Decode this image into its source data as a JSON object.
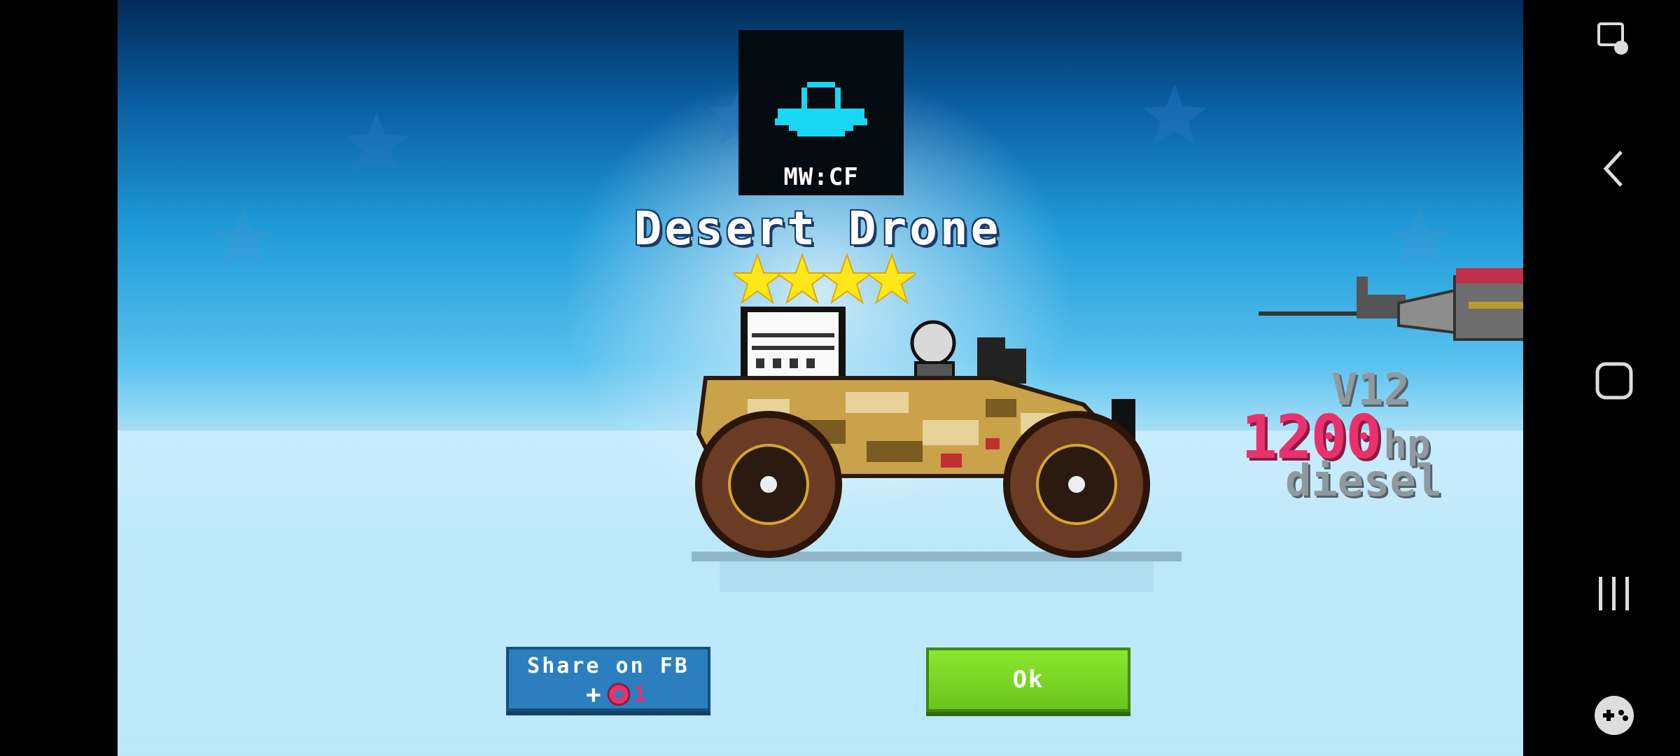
{
  "badge": {
    "label": "MW:CF",
    "icon": "ufo-icon"
  },
  "vehicle": {
    "name": "Desert Drone",
    "stars": 4,
    "stars_max": 4
  },
  "engine": {
    "type": "V12",
    "hp": "1200",
    "unit": "hp",
    "fuel": "diesel"
  },
  "buttons": {
    "share": {
      "label": "Share on FB",
      "reward_plus": "+",
      "reward_count": "1",
      "reward_icon": "donut-icon"
    },
    "ok": {
      "label": "Ok"
    }
  },
  "nav": {
    "icons": [
      "screen-touch-icon",
      "back-icon",
      "home-icon",
      "recents-icon",
      "game-controller-icon"
    ]
  },
  "colors": {
    "ok_green": "#7ad424",
    "share_blue": "#2b7fbf",
    "hp_pink": "#e8326e",
    "badge_cyan": "#19d6f2",
    "star_yellow": "#ffe81a"
  }
}
